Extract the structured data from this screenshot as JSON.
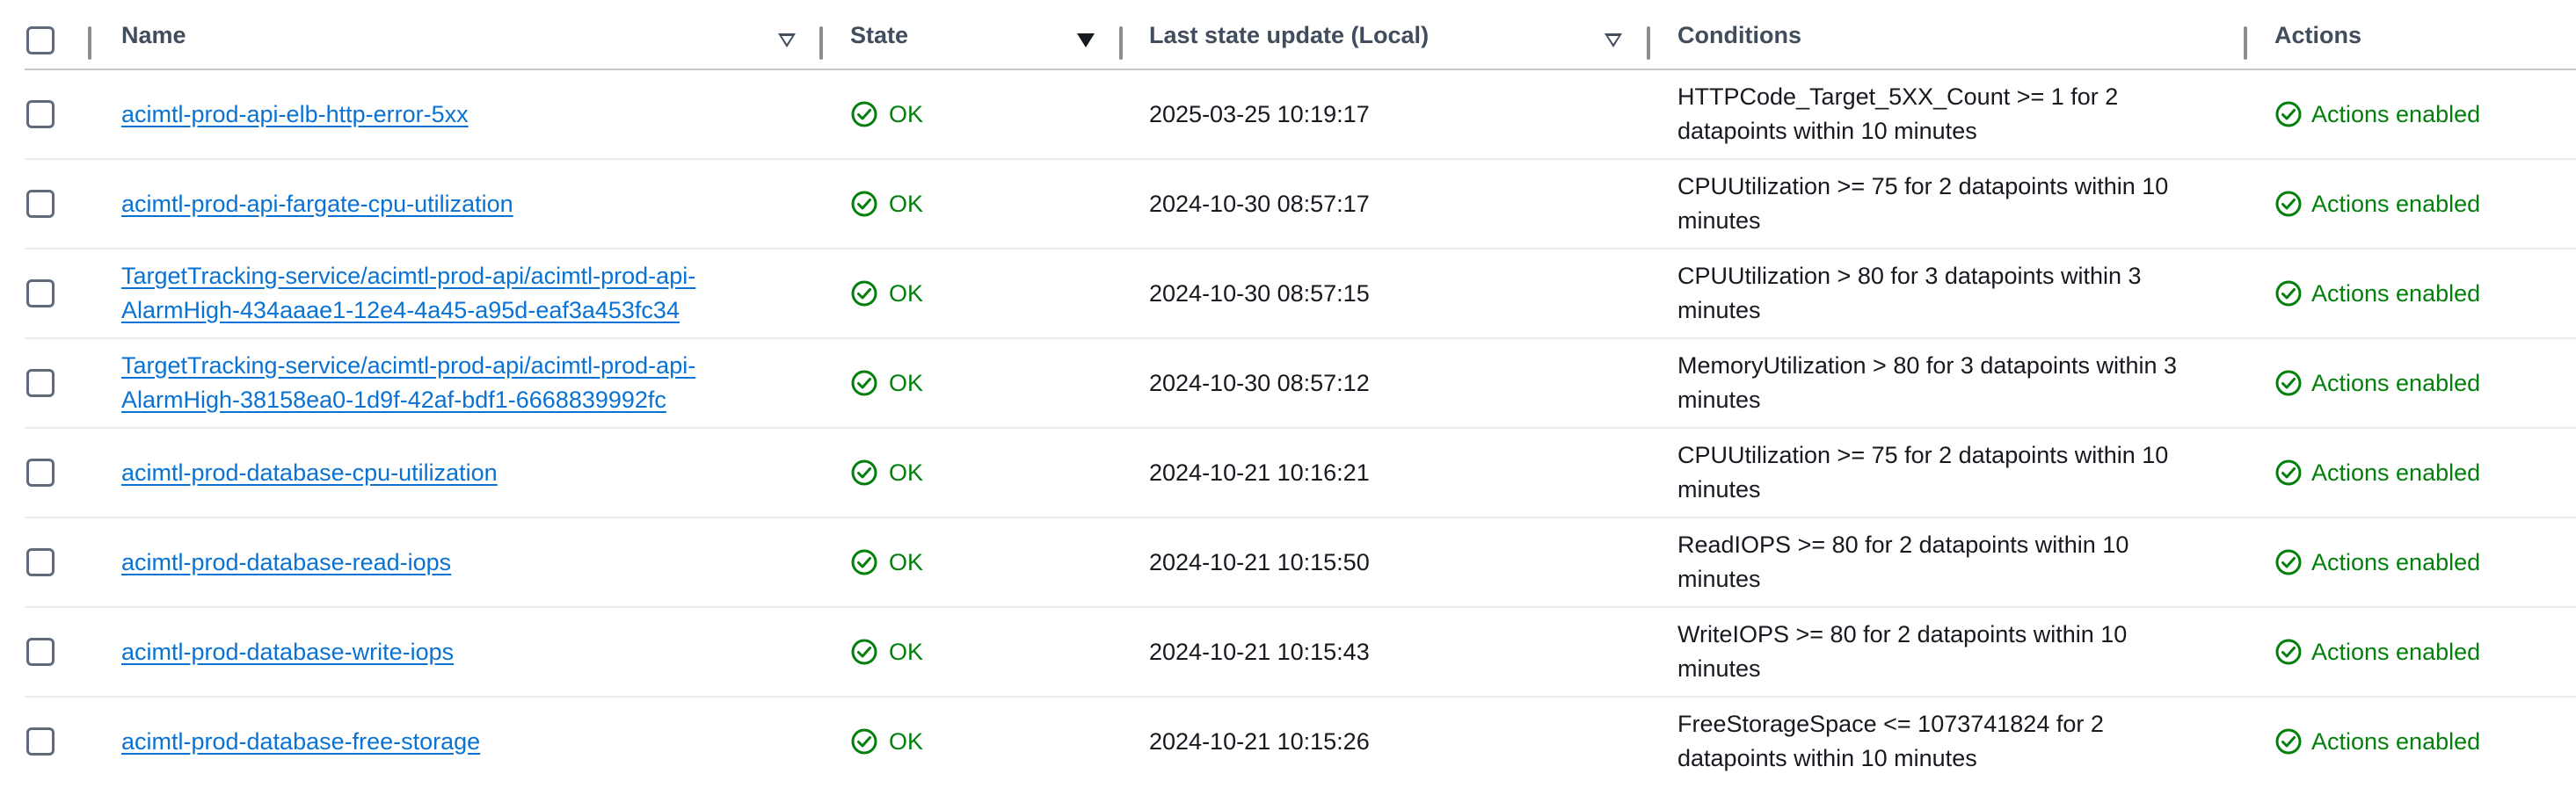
{
  "header": {
    "name": "Name",
    "state": "State",
    "last_update": "Last state update (Local)",
    "conditions": "Conditions",
    "actions": "Actions"
  },
  "colors": {
    "link": "#0972d3",
    "ok": "#037f0c",
    "header_text": "#414d5c"
  },
  "rows": [
    {
      "name": "acimtl-prod-api-elb-http-error-5xx",
      "state": "OK",
      "updated": "2025-03-25 10:19:17",
      "conditions": "HTTPCode_Target_5XX_Count >= 1 for 2 datapoints within 10 minutes",
      "actions": "Actions enabled"
    },
    {
      "name": "acimtl-prod-api-fargate-cpu-utilization",
      "state": "OK",
      "updated": "2024-10-30 08:57:17",
      "conditions": "CPUUtilization >= 75 for 2 datapoints within 10 minutes",
      "actions": "Actions enabled"
    },
    {
      "name": "TargetTracking-service/acimtl-prod-api/acimtl-prod-api-AlarmHigh-434aaae1-12e4-4a45-a95d-eaf3a453fc34",
      "state": "OK",
      "updated": "2024-10-30 08:57:15",
      "conditions": "CPUUtilization > 80 for 3 datapoints within 3 minutes",
      "actions": "Actions enabled"
    },
    {
      "name": "TargetTracking-service/acimtl-prod-api/acimtl-prod-api-AlarmHigh-38158ea0-1d9f-42af-bdf1-6668839992fc",
      "state": "OK",
      "updated": "2024-10-30 08:57:12",
      "conditions": "MemoryUtilization > 80 for 3 datapoints within 3 minutes",
      "actions": "Actions enabled"
    },
    {
      "name": "acimtl-prod-database-cpu-utilization",
      "state": "OK",
      "updated": "2024-10-21 10:16:21",
      "conditions": "CPUUtilization >= 75 for 2 datapoints within 10 minutes",
      "actions": "Actions enabled"
    },
    {
      "name": "acimtl-prod-database-read-iops",
      "state": "OK",
      "updated": "2024-10-21 10:15:50",
      "conditions": "ReadIOPS >= 80 for 2 datapoints within 10 minutes",
      "actions": "Actions enabled"
    },
    {
      "name": "acimtl-prod-database-write-iops",
      "state": "OK",
      "updated": "2024-10-21 10:15:43",
      "conditions": "WriteIOPS >= 80 for 2 datapoints within 10 minutes",
      "actions": "Actions enabled"
    },
    {
      "name": "acimtl-prod-database-free-storage",
      "state": "OK",
      "updated": "2024-10-21 10:15:26",
      "conditions": "FreeStorageSpace <= 1073741824 for 2 datapoints within 10 minutes",
      "actions": "Actions enabled"
    }
  ]
}
